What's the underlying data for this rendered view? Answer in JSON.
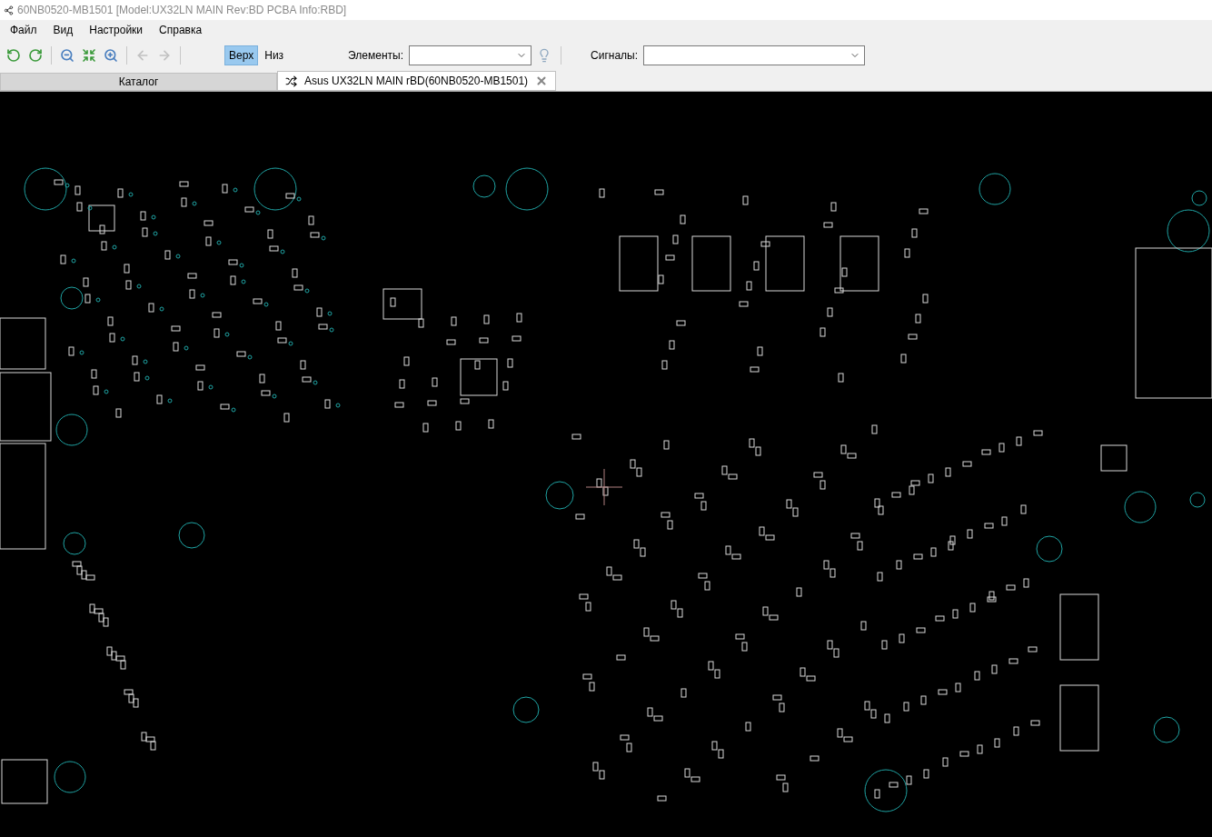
{
  "window": {
    "title": "60NB0520-MB1501 [Model:UX32LN MAIN Rev:BD PCBA Info:RBD]"
  },
  "menu": [
    "Файл",
    "Вид",
    "Настройки",
    "Справка"
  ],
  "toolbar": {
    "layers": [
      {
        "label": "Верх",
        "selected": true
      },
      {
        "label": "Низ",
        "selected": false
      }
    ],
    "elements": {
      "label": "Элементы:"
    },
    "signals": {
      "label": "Сигналы:"
    }
  },
  "tabs": [
    {
      "label": "Каталог",
      "selected": false,
      "closable": false
    },
    {
      "label": "Asus UX32LN MAIN rBD(60NB0520-MB1501)",
      "selected": true,
      "closable": true
    }
  ]
}
